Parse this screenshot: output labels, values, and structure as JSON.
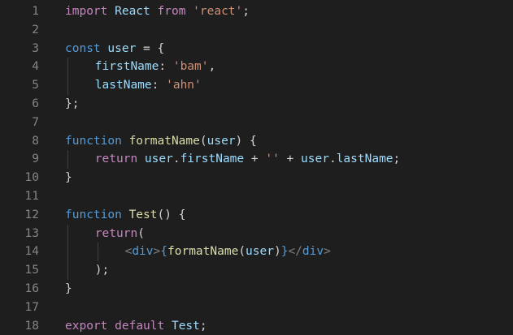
{
  "editor": {
    "colors": {
      "background": "#1e1e1e",
      "line_number": "#858585",
      "keyword_control": "#c586c0",
      "keyword_declaration": "#569cd6",
      "variable": "#9cdcfe",
      "string": "#ce9178",
      "function": "#dcdcaa",
      "punctuation": "#d4d4d4",
      "tag_bracket": "#808080"
    },
    "lines": [
      {
        "number": "1",
        "indent": 0,
        "tokens": [
          {
            "text": "import",
            "type": "kw"
          },
          {
            "text": " React ",
            "type": "var"
          },
          {
            "text": "from",
            "type": "kw"
          },
          {
            "text": " ",
            "type": "plain"
          },
          {
            "text": "'react'",
            "type": "str"
          },
          {
            "text": ";",
            "type": "punct"
          }
        ]
      },
      {
        "number": "2",
        "indent": 0,
        "tokens": []
      },
      {
        "number": "3",
        "indent": 0,
        "tokens": [
          {
            "text": "const",
            "type": "decl"
          },
          {
            "text": " ",
            "type": "plain"
          },
          {
            "text": "user",
            "type": "var"
          },
          {
            "text": " = {",
            "type": "punct"
          }
        ]
      },
      {
        "number": "4",
        "indent": 1,
        "tokens": [
          {
            "text": "firstName",
            "type": "prop"
          },
          {
            "text": ": ",
            "type": "punct"
          },
          {
            "text": "'bam'",
            "type": "str"
          },
          {
            "text": ",",
            "type": "punct"
          }
        ]
      },
      {
        "number": "5",
        "indent": 1,
        "tokens": [
          {
            "text": "lastName",
            "type": "prop"
          },
          {
            "text": ": ",
            "type": "punct"
          },
          {
            "text": "'ahn'",
            "type": "str"
          }
        ]
      },
      {
        "number": "6",
        "indent": 0,
        "tokens": [
          {
            "text": "};",
            "type": "punct"
          }
        ]
      },
      {
        "number": "7",
        "indent": 0,
        "tokens": []
      },
      {
        "number": "8",
        "indent": 0,
        "tokens": [
          {
            "text": "function",
            "type": "decl"
          },
          {
            "text": " ",
            "type": "plain"
          },
          {
            "text": "formatName",
            "type": "fn"
          },
          {
            "text": "(",
            "type": "punct"
          },
          {
            "text": "user",
            "type": "var"
          },
          {
            "text": ") {",
            "type": "punct"
          }
        ]
      },
      {
        "number": "9",
        "indent": 1,
        "tokens": [
          {
            "text": "return",
            "type": "kw"
          },
          {
            "text": " ",
            "type": "plain"
          },
          {
            "text": "user",
            "type": "var"
          },
          {
            "text": ".",
            "type": "punct"
          },
          {
            "text": "firstName",
            "type": "prop"
          },
          {
            "text": " + ",
            "type": "op"
          },
          {
            "text": "''",
            "type": "str"
          },
          {
            "text": " + ",
            "type": "op"
          },
          {
            "text": "user",
            "type": "var"
          },
          {
            "text": ".",
            "type": "punct"
          },
          {
            "text": "lastName",
            "type": "prop"
          },
          {
            "text": ";",
            "type": "punct"
          }
        ]
      },
      {
        "number": "10",
        "indent": 0,
        "tokens": [
          {
            "text": "}",
            "type": "punct"
          }
        ]
      },
      {
        "number": "11",
        "indent": 0,
        "tokens": []
      },
      {
        "number": "12",
        "indent": 0,
        "tokens": [
          {
            "text": "function",
            "type": "decl"
          },
          {
            "text": " ",
            "type": "plain"
          },
          {
            "text": "Test",
            "type": "fn"
          },
          {
            "text": "() {",
            "type": "punct"
          }
        ]
      },
      {
        "number": "13",
        "indent": 1,
        "tokens": [
          {
            "text": "return",
            "type": "kw"
          },
          {
            "text": "(",
            "type": "punct"
          }
        ]
      },
      {
        "number": "14",
        "indent": 2,
        "tokens": [
          {
            "text": "<",
            "type": "tagp"
          },
          {
            "text": "div",
            "type": "tag"
          },
          {
            "text": ">",
            "type": "tagp"
          },
          {
            "text": "{",
            "type": "decl"
          },
          {
            "text": "formatName",
            "type": "fn"
          },
          {
            "text": "(",
            "type": "punct"
          },
          {
            "text": "user",
            "type": "var"
          },
          {
            "text": ")",
            "type": "punct"
          },
          {
            "text": "}",
            "type": "decl"
          },
          {
            "text": "</",
            "type": "tagp"
          },
          {
            "text": "div",
            "type": "tag"
          },
          {
            "text": ">",
            "type": "tagp"
          }
        ]
      },
      {
        "number": "15",
        "indent": 1,
        "tokens": [
          {
            "text": ");",
            "type": "punct"
          }
        ]
      },
      {
        "number": "16",
        "indent": 0,
        "tokens": [
          {
            "text": "}",
            "type": "punct"
          }
        ]
      },
      {
        "number": "17",
        "indent": 0,
        "tokens": []
      },
      {
        "number": "18",
        "indent": 0,
        "tokens": [
          {
            "text": "export",
            "type": "kw"
          },
          {
            "text": " ",
            "type": "plain"
          },
          {
            "text": "default",
            "type": "kw"
          },
          {
            "text": " ",
            "type": "plain"
          },
          {
            "text": "Test",
            "type": "var"
          },
          {
            "text": ";",
            "type": "punct"
          }
        ]
      }
    ]
  }
}
